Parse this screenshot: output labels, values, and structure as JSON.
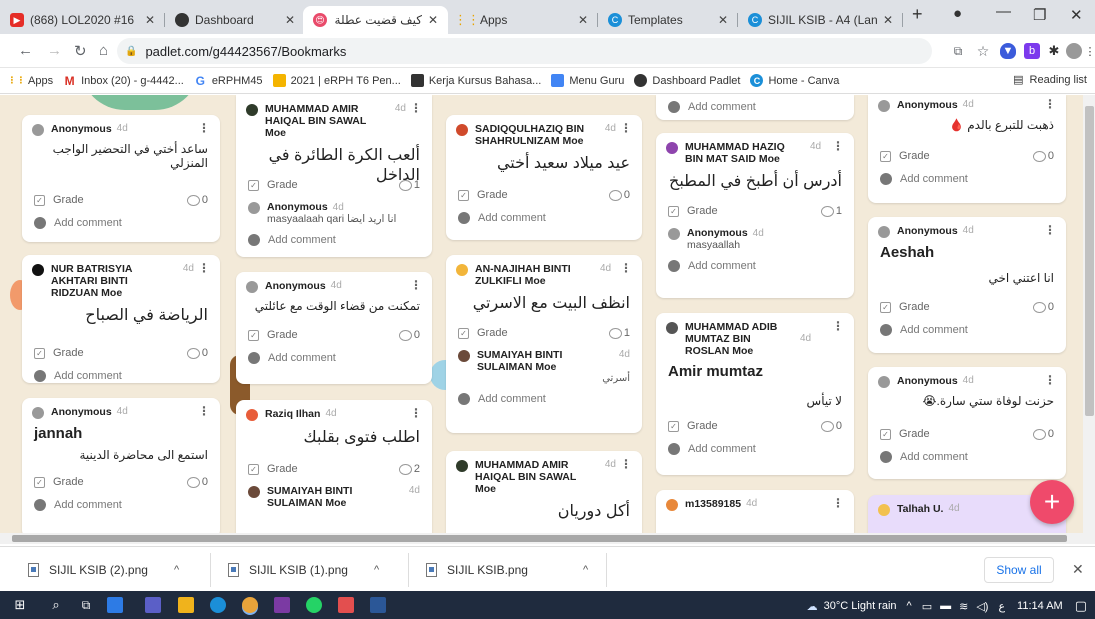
{
  "tabs": [
    {
      "label": "(868) LOL2020 #16",
      "icon": "youtube-icon",
      "color": "#e52d27"
    },
    {
      "label": "Dashboard",
      "icon": "padlet-icon",
      "color": "#333333"
    },
    {
      "label": "كيف قضيت عطلة بـ",
      "icon": "emoji-icon",
      "color": "#e94b6b"
    },
    {
      "label": "Apps",
      "icon": "apps-grid-icon",
      "color": "#e8a400"
    },
    {
      "label": "Templates",
      "icon": "canva-icon",
      "color": "#1b8fd8"
    },
    {
      "label": "SIJIL KSIB - A4 (Lan",
      "icon": "canva-icon",
      "color": "#1b8fd8"
    }
  ],
  "address": {
    "url": "padlet.com/g44423567/Bookmarks"
  },
  "bookmarks": [
    {
      "label": "Apps",
      "icon": "apps-grid-icon",
      "color": "#e8a400"
    },
    {
      "label": "Inbox (20) - g-4442...",
      "icon": "gmail-icon",
      "color": "#d93025"
    },
    {
      "label": "eRPHM45",
      "icon": "google-icon",
      "color": "#4285f4"
    },
    {
      "label": "2021 | eRPH T6 Pen...",
      "icon": "bookmark-icon",
      "color": "#f4b400"
    },
    {
      "label": "Kerja Kursus Bahasa...",
      "icon": "bookmark-icon",
      "color": "#333333"
    },
    {
      "label": "Menu Guru",
      "icon": "bookmark-icon",
      "color": "#4285f4"
    },
    {
      "label": "Dashboard Padlet",
      "icon": "padlet-icon",
      "color": "#333333"
    },
    {
      "label": "Home - Canva",
      "icon": "canva-icon",
      "color": "#1b8fd8"
    }
  ],
  "reading_list": "Reading list",
  "common": {
    "grade": "Grade",
    "add_comment": "Add comment"
  },
  "cards": {
    "c1": {
      "name": "Anonymous",
      "time": "4d",
      "body": "ساعد أختي في التحضير الواجب المنزلي",
      "count": "0"
    },
    "c2": {
      "name": "NUR BATRISYIA AKHTARI BINTI RIDZUAN Moe",
      "time": "4d",
      "title": "الرياضة في الصباح",
      "count": "0"
    },
    "c3": {
      "name": "Anonymous",
      "time": "4d",
      "title": "jannah",
      "body": "استمع الى محاضرة الدينية",
      "count": "0"
    },
    "c4": {
      "name": "MUHAMMAD AMIR HAIQAL BIN SAWAL Moe",
      "time": "4d",
      "title": "ألعب الكرة الطائرة في الداخل",
      "count": "1",
      "cname": "Anonymous",
      "ctime": "4d",
      "ctext": "masyaalaah qari انا اريد ايضا"
    },
    "c5": {
      "name": "Anonymous",
      "time": "4d",
      "body": "تمكنت من قضاء الوقت مع عائلتي",
      "count": "0"
    },
    "c6": {
      "name": "Raziq Ilhan",
      "time": "4d",
      "title": "اطلب فتوى بقلبك",
      "count": "2",
      "cname": "SUMAIYAH BINTI SULAIMAN Moe",
      "ctime": "4d"
    },
    "c7": {
      "name": "SADIQQULHAZIQ BIN SHAHRULNIZAM Moe",
      "time": "4d",
      "title": "عيد ميلاد سعيد أختي",
      "count": "0"
    },
    "c8": {
      "name": "AN-NAJIHAH BINTI ZULKIFLI Moe",
      "time": "4d",
      "title": "انظف البيت مع الاسرتي",
      "count": "1",
      "cname": "SUMAIYAH BINTI SULAIMAN Moe",
      "ctime": "4d",
      "ctext": "أسرتي"
    },
    "c9": {
      "name": "MUHAMMAD AMIR HAIQAL BIN SAWAL Moe",
      "time": "4d",
      "title": "أكل دوريان"
    },
    "c10": {
      "name": "MUHAMMAD HAZIQ BIN MAT SAID Moe",
      "time": "4d",
      "title": "أدرس أن أطبخ في المطبخ",
      "count": "1",
      "cname": "Anonymous",
      "ctime": "4d",
      "ctext": "masyaallah"
    },
    "c11": {
      "name": "MUHAMMAD ADIB MUMTAZ BIN ROSLAN Moe",
      "time": "4d",
      "title": "Amir mumtaz",
      "body": "لا تيأس",
      "count": "0"
    },
    "c12": {
      "name": "m13589185",
      "time": "4d"
    },
    "c13": {
      "name": "Anonymous",
      "time": "4d",
      "body": "ذهبت للتبرع بالدم 🩸",
      "count": "0"
    },
    "c14": {
      "name": "Anonymous",
      "time": "4d",
      "title": "Aeshah",
      "body": "انا اعتني اخي",
      "count": "0"
    },
    "c15": {
      "name": "Anonymous",
      "time": "4d",
      "body": "حزنت لوفاة ستي سارة.😭",
      "count": "0"
    },
    "c16": {
      "name": "Talhah U.",
      "time": "4d"
    }
  },
  "fab": "+",
  "downloads": [
    {
      "name": "SIJIL KSIB (2).png"
    },
    {
      "name": "SIJIL KSIB (1).png"
    },
    {
      "name": "SIJIL KSIB.png"
    }
  ],
  "show_all": "Show all",
  "tray": {
    "weather": "30°C  Light rain",
    "lang": "ع",
    "time": "11:14 AM"
  }
}
